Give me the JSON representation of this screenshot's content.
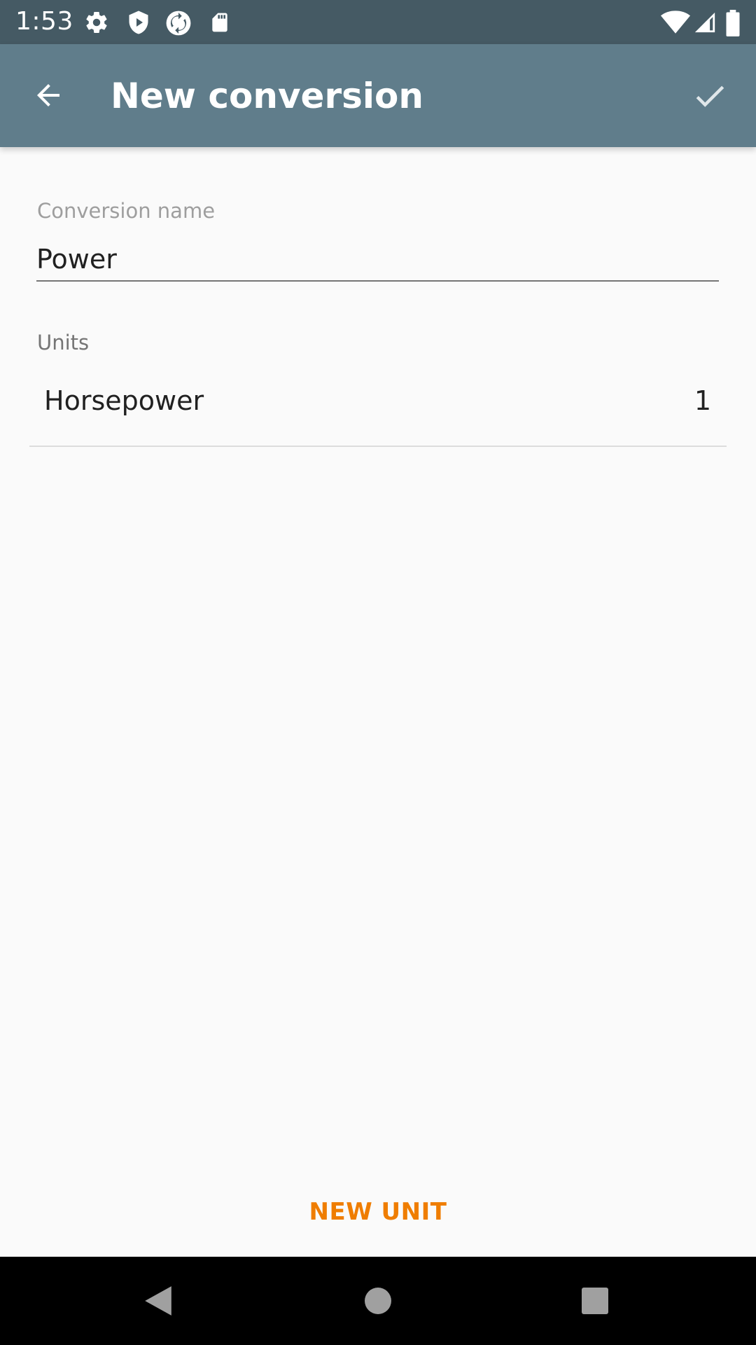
{
  "status_bar": {
    "time": "1:53",
    "icons_left": [
      "settings-icon",
      "play-shield-icon",
      "sync-icon",
      "sd-card-icon"
    ],
    "icons_right": [
      "wifi-icon",
      "cell-signal-icon",
      "battery-icon"
    ]
  },
  "app_bar": {
    "title": "New conversion",
    "back_icon": "arrow-back-icon",
    "confirm_icon": "check-icon",
    "color": "#607d8b"
  },
  "form": {
    "name_label": "Conversion name",
    "name_value": "Power",
    "units_label": "Units",
    "units": [
      {
        "name": "Horsepower",
        "value": "1"
      }
    ]
  },
  "actions": {
    "new_unit_label": "NEW UNIT",
    "accent_color": "#ef7d00"
  },
  "nav_bar": {
    "icons": [
      "back-triangle-icon",
      "home-circle-icon",
      "recents-square-icon"
    ]
  }
}
